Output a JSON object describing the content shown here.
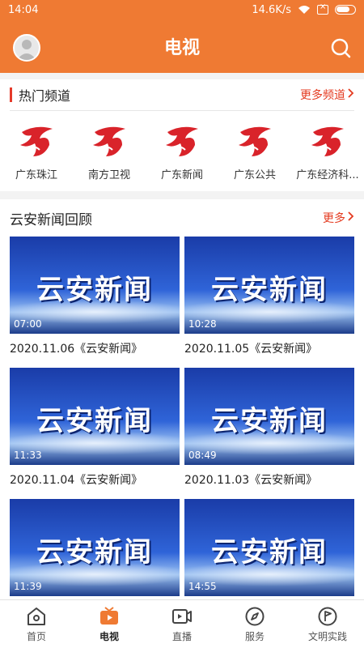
{
  "status_bar": {
    "time": "14:04",
    "network_speed": "14.6K/s"
  },
  "header": {
    "title": "电视"
  },
  "hot_channels": {
    "title": "热门频道",
    "more_label": "更多频道",
    "items": [
      {
        "name": "广东珠江"
      },
      {
        "name": "南方卫视"
      },
      {
        "name": "广东新闻"
      },
      {
        "name": "广东公共"
      },
      {
        "name": "广东经济科..."
      }
    ]
  },
  "review": {
    "title": "云安新闻回顾",
    "more_label": "更多",
    "thumb_text": "云安新闻",
    "items": [
      {
        "duration": "07:00",
        "caption": "2020.11.06《云安新闻》"
      },
      {
        "duration": "10:28",
        "caption": "2020.11.05《云安新闻》"
      },
      {
        "duration": "11:33",
        "caption": "2020.11.04《云安新闻》"
      },
      {
        "duration": "08:49",
        "caption": "2020.11.03《云安新闻》"
      },
      {
        "duration": "11:39",
        "caption": ""
      },
      {
        "duration": "14:55",
        "caption": ""
      }
    ]
  },
  "bottom_nav": {
    "items": [
      {
        "label": "首页",
        "icon": "home-icon"
      },
      {
        "label": "电视",
        "icon": "tv-icon",
        "active": true
      },
      {
        "label": "直播",
        "icon": "live-video-icon"
      },
      {
        "label": "服务",
        "icon": "compass-icon"
      },
      {
        "label": "文明实践",
        "icon": "flag-icon"
      }
    ]
  },
  "colors": {
    "brand": "#ef7a33",
    "accent_red": "#e43a1f"
  }
}
